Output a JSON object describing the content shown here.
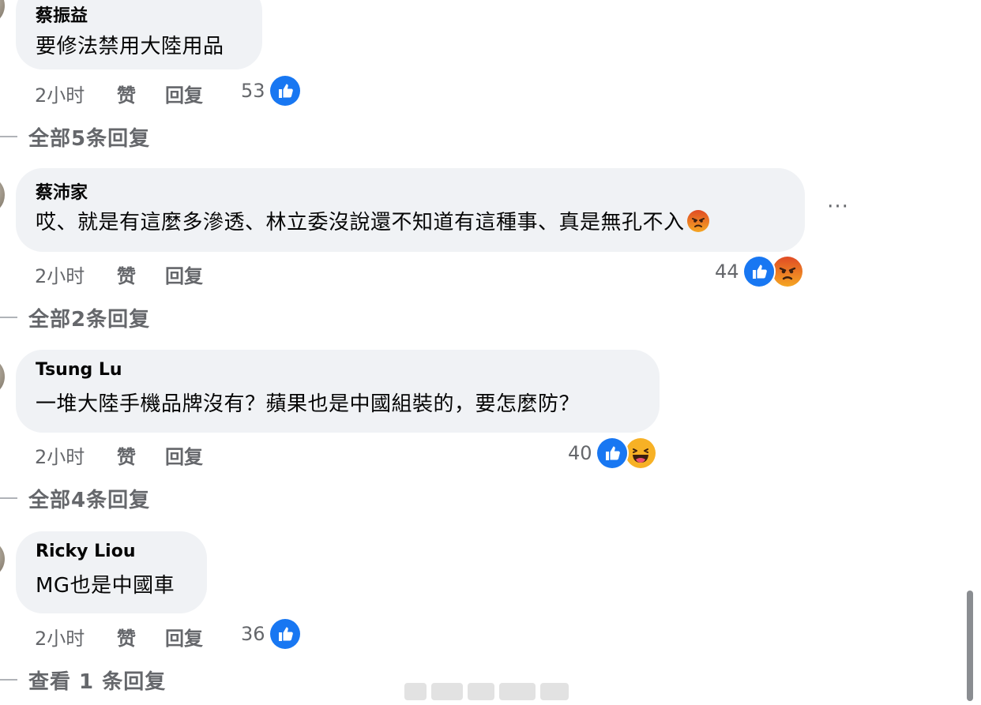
{
  "comments": [
    {
      "author": "蔡振益",
      "text": "要修法禁用大陸用品",
      "time": "2小时",
      "like_label": "赞",
      "reply_label": "回复",
      "reaction_count": "53",
      "reactions": [
        "like"
      ],
      "view_replies": "全部5条回复"
    },
    {
      "author": "蔡沛家",
      "text": "哎、就是有這麼多滲透、林立委沒說還不知道有這種事、真是無孔不入",
      "time": "2小时",
      "like_label": "赞",
      "reply_label": "回复",
      "reaction_count": "44",
      "reactions": [
        "like",
        "angry"
      ],
      "view_replies": "全部2条回复"
    },
    {
      "author": "Tsung Lu",
      "text": "一堆大陸手機品牌沒有？蘋果也是中國組裝的，要怎麼防？",
      "time": "2小时",
      "like_label": "赞",
      "reply_label": "回复",
      "reaction_count": "40",
      "reactions": [
        "like",
        "haha"
      ],
      "view_replies": "全部4条回复"
    },
    {
      "author": "Ricky Liou",
      "text": "MG也是中國車",
      "time": "2小时",
      "like_label": "赞",
      "reply_label": "回复",
      "reaction_count": "36",
      "reactions": [
        "like"
      ],
      "view_replies": "查看 1 条回复"
    }
  ],
  "more_options_label": "···",
  "colors": {
    "bubble": "#f0f2f5",
    "like_blue": "#1877f2",
    "secondary_text": "#65676b",
    "angry_red": "#e9710f",
    "haha_yellow": "#f7b125"
  }
}
